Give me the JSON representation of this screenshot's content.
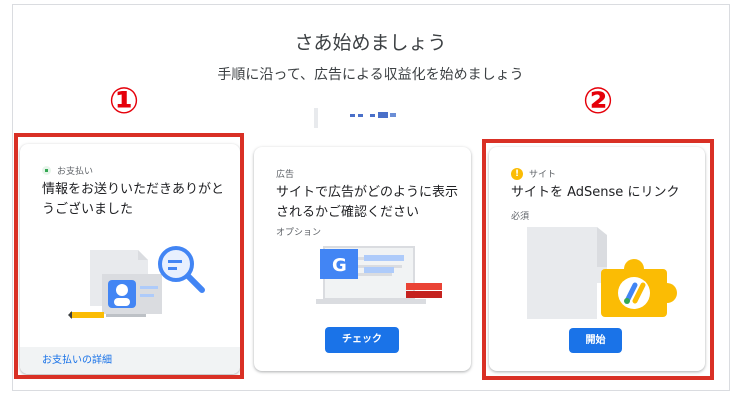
{
  "header": {
    "title": "さあ始めましょう",
    "subtitle": "手順に沿って、広告による収益化を始めましょう"
  },
  "annotations": {
    "badge1": "①",
    "badge2": "②"
  },
  "cards": [
    {
      "label": "お支払い",
      "title_line1": "情報をお送りいただきありがと",
      "title_line2": "うございました",
      "footer_link": "お支払いの詳細",
      "status_icon": "check-square-icon",
      "status_color": "#34a853"
    },
    {
      "label": "広告",
      "title_line1": "サイトで広告がどのように表示",
      "title_line2": "されるかご確認ください",
      "note": "オプション",
      "button": "チェック"
    },
    {
      "label": "サイト",
      "title_line1": "サイトを AdSense にリンク",
      "note": "必須",
      "button": "開始",
      "status_icon": "alert-circle-icon",
      "status_color": "#fbbc04"
    }
  ],
  "colors": {
    "accent": "#1a73e8",
    "highlight": "#d93025"
  }
}
